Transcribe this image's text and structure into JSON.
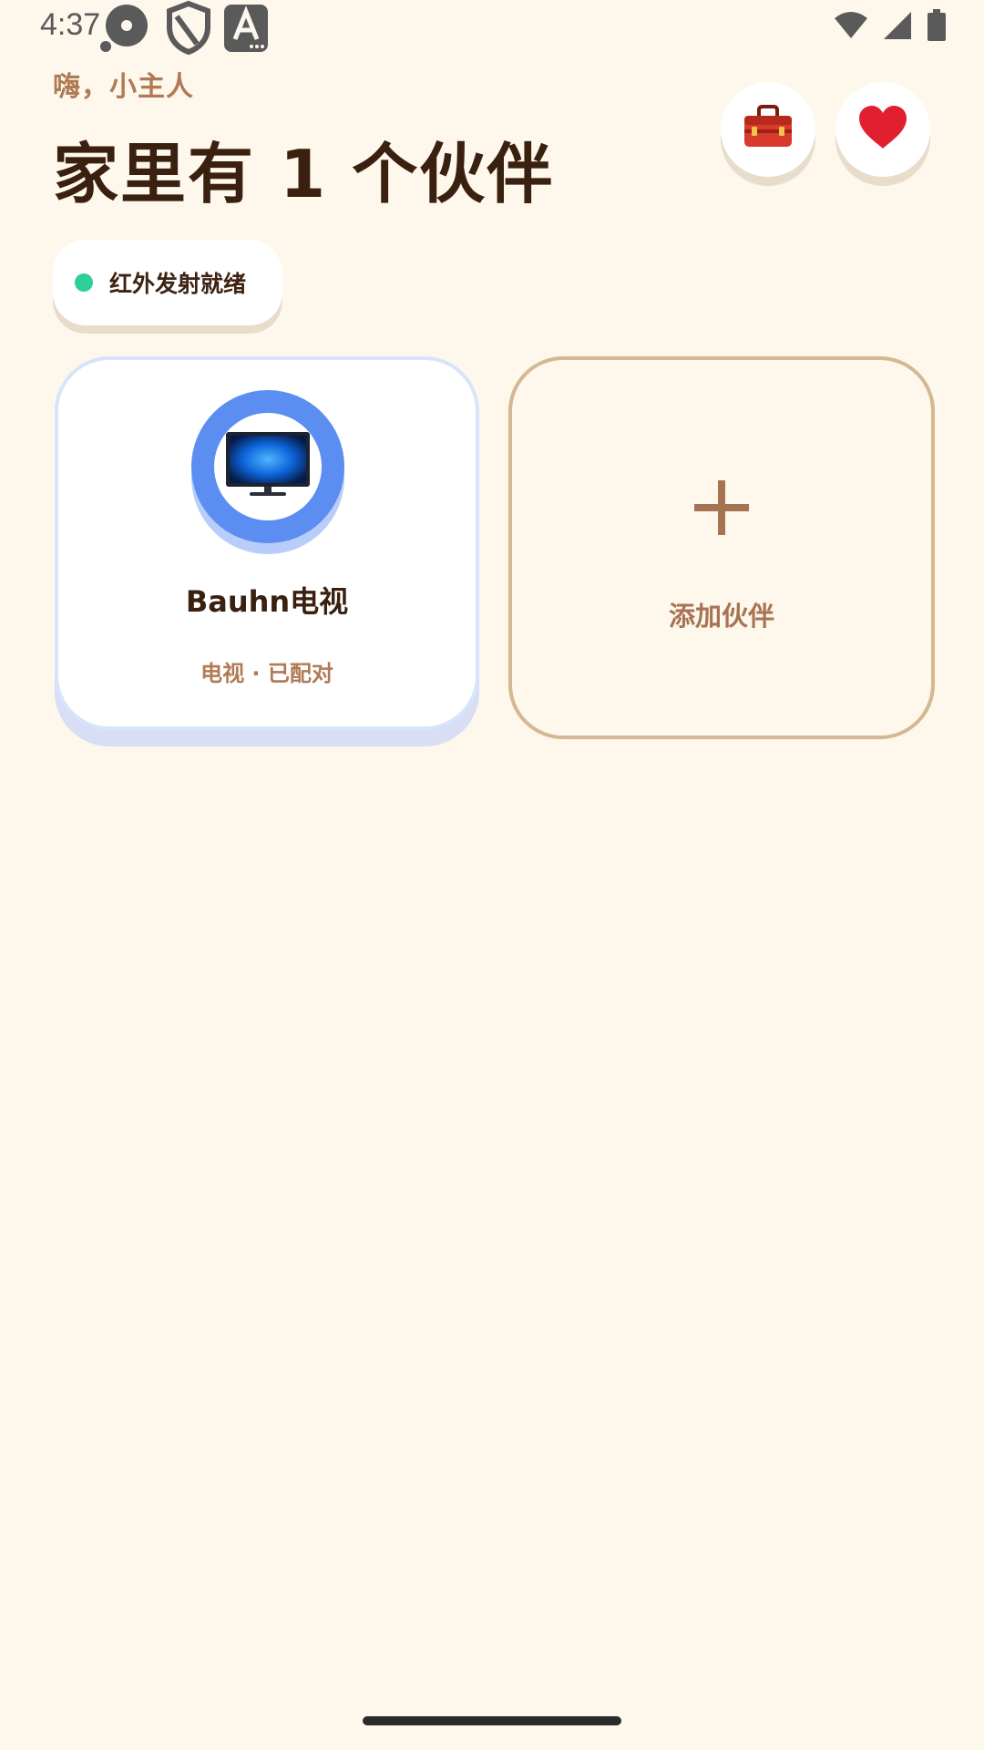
{
  "status_bar": {
    "time": "4:37",
    "left_icons": [
      "media-icon",
      "shield-icon",
      "text-a-icon"
    ],
    "right_icons": [
      "wifi-icon",
      "signal-icon",
      "battery-icon"
    ]
  },
  "header": {
    "greeting": "嗨，小主人",
    "title": "家里有 1 个伙伴",
    "toolbox_icon": "toolbox-icon",
    "favorite_icon": "heart-icon"
  },
  "ir_status": {
    "label": "红外发射就绪",
    "dot_color": "#2ecf96"
  },
  "devices": [
    {
      "name": "Bauhn电视",
      "status": "电视 · 已配对",
      "icon": "tv-icon",
      "accent": "#5b8ef0"
    }
  ],
  "add_card": {
    "label": "添加伙伴",
    "icon": "plus-icon"
  },
  "colors": {
    "background": "#fdf7ec",
    "title": "#3a200f",
    "secondary": "#b07a55"
  }
}
